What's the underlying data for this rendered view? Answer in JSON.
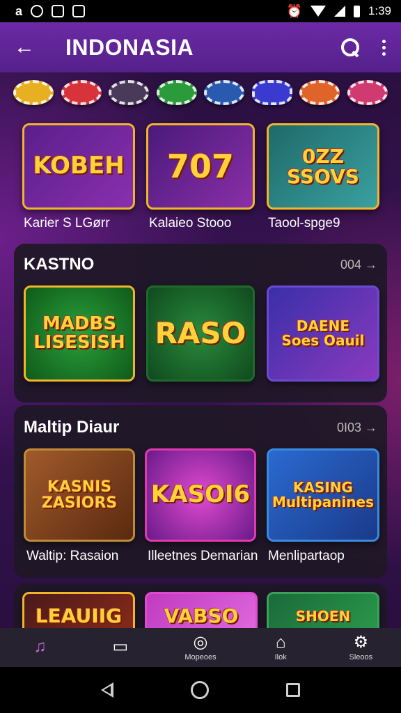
{
  "status_bar": {
    "time": "1:39"
  },
  "app_bar": {
    "title": "INDONASIA"
  },
  "top_row": {
    "cards": [
      {
        "art": "KOBEH",
        "label": "Karier S LGørr",
        "accent": "#7a2fb0"
      },
      {
        "art": "707",
        "label": "Kalaieo Stooo",
        "accent": "#8a2fa8"
      },
      {
        "art": "0ZZ\nSSOVS",
        "label": "Taool-spge9",
        "accent": "#2a8a8a"
      }
    ]
  },
  "section_kasino": {
    "title": "KASTNO",
    "more": "004",
    "cards": [
      {
        "art": "MADBS\nLISESISH",
        "accent": "#1f8a2a"
      },
      {
        "art": "RASO",
        "accent": "#1e7a32"
      },
      {
        "art": "DAENE\nSoes Oauil",
        "accent": "#6a2fa8"
      }
    ]
  },
  "section_multi": {
    "title": "Maltip Diaur",
    "more": "0I03",
    "cards": [
      {
        "art": "KASNIS\nZASIORS",
        "label": "Waltip: Rasaion",
        "accent": "#8a4a1e"
      },
      {
        "art": "KASOI6",
        "label": "Illeetnes Demarian",
        "accent": "#a02fa0"
      },
      {
        "art": "KASING\nMultipanines",
        "label": "Menlipartaop",
        "accent": "#2a4aa8"
      }
    ]
  },
  "bottom_row": {
    "cards": [
      {
        "art": "LEAUIIG",
        "accent": "#6a1f1f"
      },
      {
        "art": "VABSO",
        "accent": "#b02fb0"
      },
      {
        "art": "SHOEN",
        "accent": "#1f7a3a"
      }
    ]
  },
  "bottom_nav": {
    "items": [
      {
        "glyph": "♫",
        "label": "",
        "icon": "music-icon"
      },
      {
        "glyph": "▭",
        "label": "",
        "icon": "tv-icon"
      },
      {
        "glyph": "◎",
        "label": "Mopeoes",
        "icon": "compass-icon"
      },
      {
        "glyph": "⌂",
        "label": "Ilok",
        "icon": "bag-icon"
      },
      {
        "glyph": "⚙",
        "label": "Sleoos",
        "icon": "settings-icon"
      }
    ]
  }
}
